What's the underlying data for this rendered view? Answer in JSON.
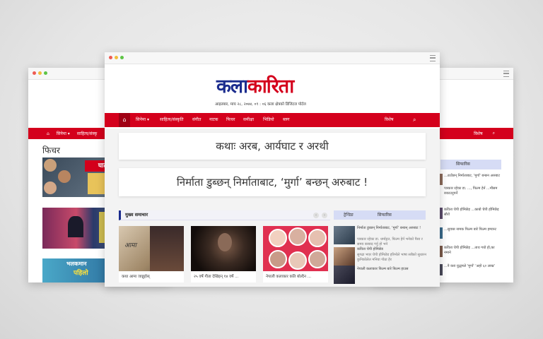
{
  "left_window": {
    "nav": [
      "सिनेमा ▾",
      "साहित्य/संस्कृ"
    ],
    "section_title": "फिचर",
    "banner_text": "घाटल",
    "bottom_banner_line1": "भलकमान",
    "bottom_banner_line2": "पहिलो"
  },
  "right_window": {
    "nav_label": "विशेष",
    "tab_label": "सिफारिस",
    "items": [
      "...ठाउँछन् निर्माताबाट, 'मुर्गा' बन्छन अरुबाट",
      "पत्रकार रहेका डा. ..., फिल्म हेर्न ...मौसम रुकाउनुपर्ने",
      "कविता चेपी होमिछेड़ ...काबो चेपी होमिछेड़ सौरो",
      "...सुवास नामक फिल्म बारे फिल्म इम्यान्ट",
      "कविता चेपी होमिछेड़ ...ताथ गयो हो,का नमाने",
      "...नै करा युद्धमले 'मुर्गा' 'अहो ६२ लाख'"
    ]
  },
  "main_window": {
    "logo_part1": "कला",
    "logo_part2": "कारिता",
    "date_line": "आइतबार, माघ २८, २०७४, ०९ : ०६   कला क्षेत्रको डिजिटल पोर्टल",
    "nav": {
      "items": [
        "सिनेमा ▾",
        "साहित्य/संस्कृति",
        "संगीत",
        "नाटक",
        "फिचर",
        "समीक्षा",
        "भिडियो",
        "ब्लग"
      ],
      "right_label": "विशेष"
    },
    "headline1": "कथाः अरब, आर्यघाट र अरथी",
    "headline2": "निर्माता डुब्छन् निर्माताबाट, ‘मुर्गा’ बन्छन् अरुबाट !",
    "section_label": "मुख्य समाचार",
    "cards": [
      {
        "caption": "कथा आमा जान्नुहोस्",
        "image_text": "आमा"
      },
      {
        "caption": "२५ वर्षे गीता देखिइन् १४ वर्षे ..."
      },
      {
        "caption": "नेपाली कलाकार कति बोल्दैन ..."
      }
    ],
    "right_tabs": [
      "ट्रेन्डिङ",
      "सिफारिस"
    ],
    "right_items": [
      "निर्माता डुब्छन् निर्माताबाट, ‘मुर्गा’ बन्छन् अरुबाट !",
      "पत्रकार रहेका डा. धर्माङ्गत, फिल्म हेर्न भनेको पैसा र समय बरबाद गर्नु हो भने",
      "कविता चेपी होमिछेड",
      "सुगढा भएर चेपी होमिछेड हरिमोले भाषा सबैको सुधारन कुनिकोलेल मनिया गोठा हेर",
      "नेपाली कलाकार फिल्म बारे फिल्म हाउस"
    ]
  }
}
